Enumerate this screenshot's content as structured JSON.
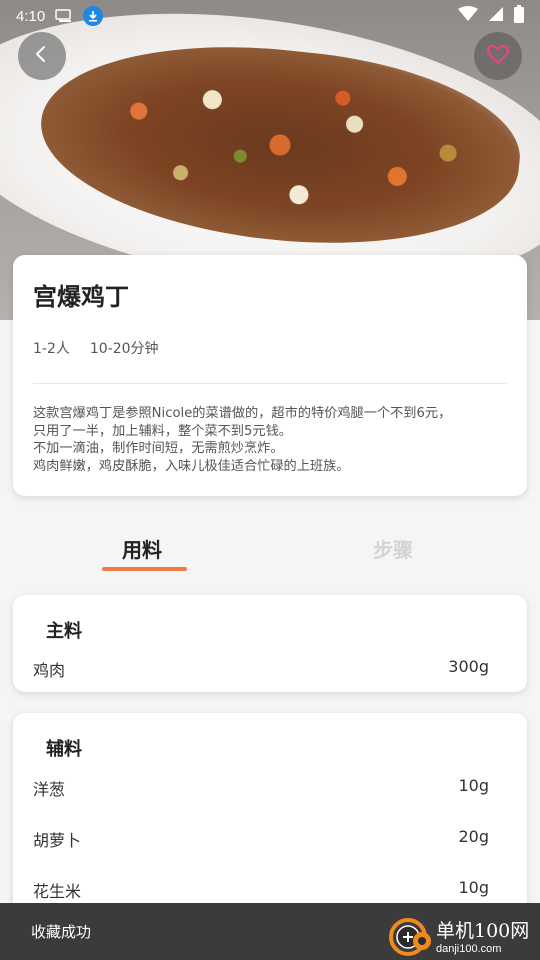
{
  "status_bar": {
    "time": "4:10"
  },
  "recipe": {
    "title": "宫爆鸡丁",
    "servings": "1-2人",
    "duration": "10-20分钟",
    "description_lines": [
      "这款宫爆鸡丁是参照Nicole的菜谱做的，超市的特价鸡腿一个不到6元，",
      "只用了一半，加上辅料，整个菜不到5元钱。",
      "不加一滴油，制作时间短，无需煎炒烹炸。",
      "鸡肉鲜嫩，鸡皮酥脆，入味儿极佳适合忙碌的上班族。"
    ]
  },
  "tabs": {
    "ingredients": "用料",
    "steps": "步骤"
  },
  "main_ingredients": {
    "title": "主料",
    "items": [
      {
        "name": "鸡肉",
        "amount": "300g"
      }
    ]
  },
  "aux_ingredients": {
    "title": "辅料",
    "items": [
      {
        "name": "洋葱",
        "amount": "10g"
      },
      {
        "name": "胡萝卜",
        "amount": "20g"
      },
      {
        "name": "花生米",
        "amount": "10g"
      }
    ]
  },
  "toast": {
    "message": "收藏成功"
  },
  "watermark": {
    "line1": "单机100网",
    "line2": "danji100.com"
  },
  "colors": {
    "accent": "#f07a45",
    "favorite_heart": "#e8457a",
    "toast_bg": "#3b3b3b",
    "download_badge": "#1e88e5"
  },
  "icons": {
    "back": "chevron-left-icon",
    "favorite": "heart-outline-icon",
    "download": "download-icon",
    "wifi": "wifi-icon",
    "signal": "signal-icon",
    "battery": "battery-icon",
    "sim": "sim-icon"
  }
}
